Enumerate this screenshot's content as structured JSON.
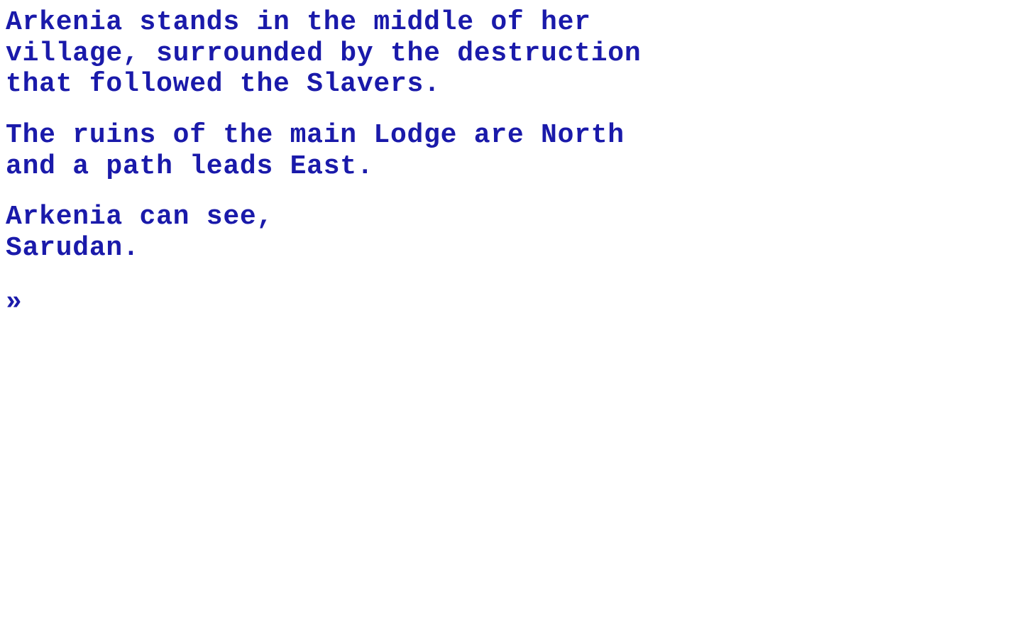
{
  "game": {
    "paragraph1": "Arkenia stands in the middle of her\nvillage, surrounded by the destruction\nthat followed the Slavers.",
    "paragraph2": "The ruins of the main Lodge are North\nand a path leads East.",
    "paragraph3": "Arkenia can see,\nSarudan.",
    "prompt": "»"
  },
  "colors": {
    "text": "#1a1aaa",
    "background": "#ffffff"
  }
}
